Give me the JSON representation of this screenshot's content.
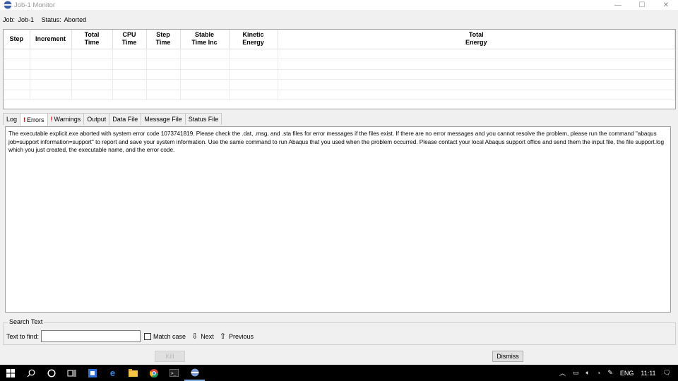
{
  "window": {
    "title": "Job-1 Monitor",
    "minimize": "—",
    "maximize": "☐",
    "close": "✕"
  },
  "job": {
    "job_label": "Job:",
    "job_value": "Job-1",
    "status_label": "Status:",
    "status_value": "Aborted"
  },
  "grid": {
    "columns": [
      {
        "line1": "Step",
        "line2": ""
      },
      {
        "line1": "Increment",
        "line2": ""
      },
      {
        "line1": "Total",
        "line2": "Time"
      },
      {
        "line1": "CPU",
        "line2": "Time"
      },
      {
        "line1": "Step",
        "line2": "Time"
      },
      {
        "line1": "Stable",
        "line2": "Time Inc"
      },
      {
        "line1": "Kinetic",
        "line2": "Energy"
      },
      {
        "line1": "Total",
        "line2": "Energy"
      }
    ]
  },
  "tabs": [
    {
      "label": "Log",
      "warn": false
    },
    {
      "label": "Errors",
      "warn": true
    },
    {
      "label": "Warnings",
      "warn": true
    },
    {
      "label": "Output",
      "warn": false
    },
    {
      "label": "Data File",
      "warn": false
    },
    {
      "label": "Message File",
      "warn": false
    },
    {
      "label": "Status File",
      "warn": false
    }
  ],
  "tab_bang": "!",
  "active_tab": "Errors",
  "message": "The executable explicit.exe aborted with system error code 1073741819. Please check the .dat, .msg, and .sta files for error messages if the files exist.  If there are no error messages and you cannot resolve the problem, please run the command \"abaqus job=support information=support\" to report and save your system information.  Use the same command to run Abaqus that you used when the problem occurred.  Please contact your local Abaqus support office and send them the input file, the file support.log which you just created, the executable name, and the error code.",
  "search": {
    "legend": "Search Text",
    "find_label": "Text to find:",
    "find_value": "",
    "match_case_label": "Match case",
    "next_label": "Next",
    "previous_label": "Previous"
  },
  "buttons": {
    "kill": "Kill",
    "dismiss": "Dismiss"
  },
  "taskbar": {
    "tray_lang": "ENG",
    "tray_time": "11:11"
  },
  "colors": {
    "warn_mark": "#e00000",
    "window_bg": "#f0f0f0",
    "taskbar_bg": "#000000"
  }
}
